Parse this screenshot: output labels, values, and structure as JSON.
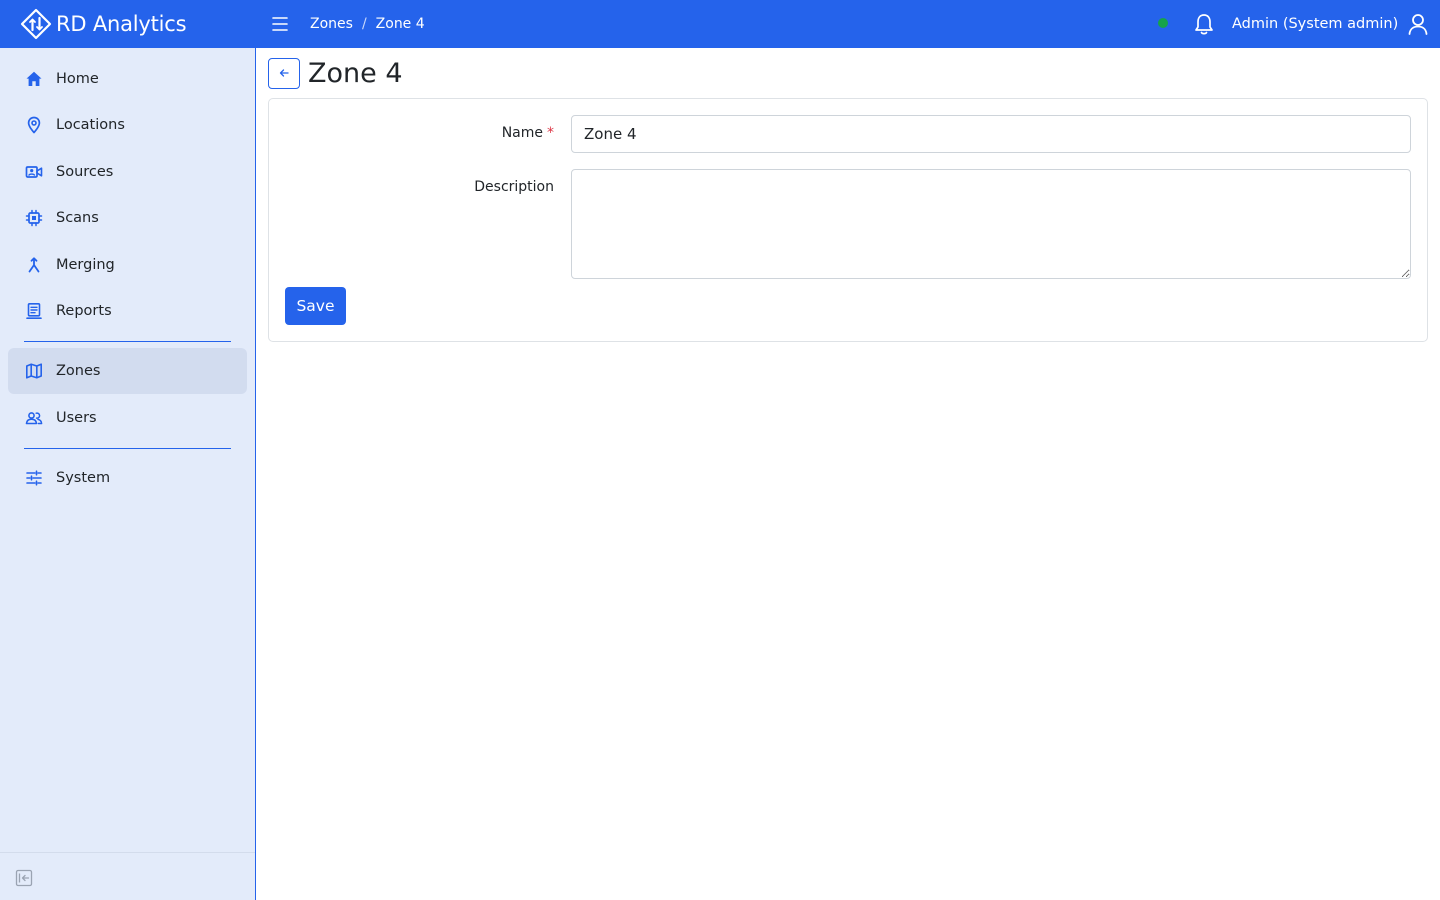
{
  "app": {
    "name": "RD Analytics",
    "brand_color": "#2563eb",
    "sidebar_bg": "#e3ebfa"
  },
  "header": {
    "breadcrumb": [
      "Zones",
      "Zone 4"
    ],
    "breadcrumb_separator": "/",
    "connection_status": "online",
    "connection_status_color": "#16a34a",
    "user_label": "Admin (System admin)"
  },
  "sidebar": {
    "items": [
      {
        "label": "Home",
        "icon": "home-icon"
      },
      {
        "label": "Locations",
        "icon": "map-pin-icon"
      },
      {
        "label": "Sources",
        "icon": "camera-icon"
      },
      {
        "label": "Scans",
        "icon": "chip-icon"
      },
      {
        "label": "Merging",
        "icon": "merge-icon"
      },
      {
        "label": "Reports",
        "icon": "report-icon"
      },
      {
        "label": "Zones",
        "icon": "map-icon",
        "active": true
      },
      {
        "label": "Users",
        "icon": "users-icon"
      },
      {
        "label": "System",
        "icon": "sliders-icon"
      }
    ]
  },
  "page": {
    "title": "Zone 4"
  },
  "form": {
    "name_label": "Name",
    "required_marker": "*",
    "name_value": "Zone 4",
    "description_label": "Description",
    "description_value": "",
    "save_label": "Save"
  }
}
